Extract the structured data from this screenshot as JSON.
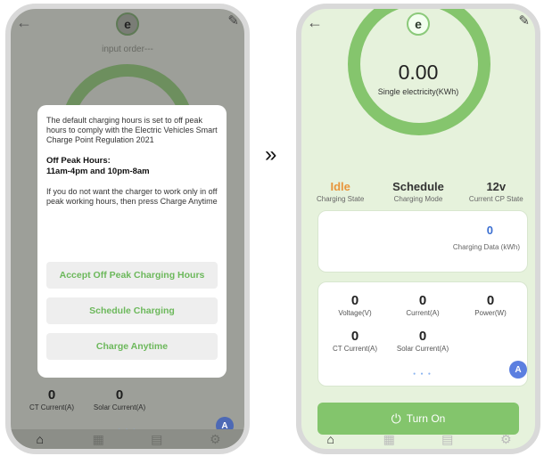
{
  "left_screen": {
    "input_placeholder": "input order---",
    "dialog": {
      "body": "The default charging hours is set to off peak hours to comply with the Electric Vehicles Smart Charge Point Regulation 2021",
      "off_peak_heading": "Off Peak Hours:",
      "off_peak_hours": "11am-4pm and 10pm-8am",
      "body2": "If you do not want the charger to work only in off peak working hours, then press Charge Anytime",
      "accept_label": "Accept Off Peak Charging Hours",
      "schedule_label": "Schedule Charging",
      "anytime_label": "Charge Anytime"
    },
    "metrics": [
      {
        "value": "0",
        "label": "CT Current(A)"
      },
      {
        "value": "0",
        "label": "Solar Current(A)"
      }
    ],
    "badge": "A"
  },
  "transition_symbol": "»",
  "right_screen": {
    "gauge_value": "0.00",
    "gauge_label": "Single electricity(KWh)",
    "state": [
      {
        "value": "Idle",
        "label": "Charging State"
      },
      {
        "value": "Schedule",
        "label": "Charging Mode"
      },
      {
        "value": "12v",
        "label": "Current CP State"
      }
    ],
    "data_card": {
      "value": "0",
      "caption": "Charging Data (kWh)"
    },
    "metrics": [
      {
        "value": "0",
        "label": "Voltage(V)"
      },
      {
        "value": "0",
        "label": "Current(A)"
      },
      {
        "value": "0",
        "label": "Power(W)"
      },
      {
        "value": "0",
        "label": "CT Current(A)"
      },
      {
        "value": "0",
        "label": "Solar Current(A)"
      }
    ],
    "badge": "A",
    "turn_on_label": "Turn On"
  },
  "icons": {
    "back": "back-arrow-icon",
    "edit": "edit-icon",
    "logo": "logo-icon",
    "home": "home-icon",
    "grid": "grid-icon",
    "document": "document-icon",
    "settings": "settings-icon",
    "power": "power-icon"
  },
  "colors": {
    "accent_green": "#83c56c",
    "idle_orange": "#e8953b",
    "data_blue": "#3b6fd1"
  }
}
